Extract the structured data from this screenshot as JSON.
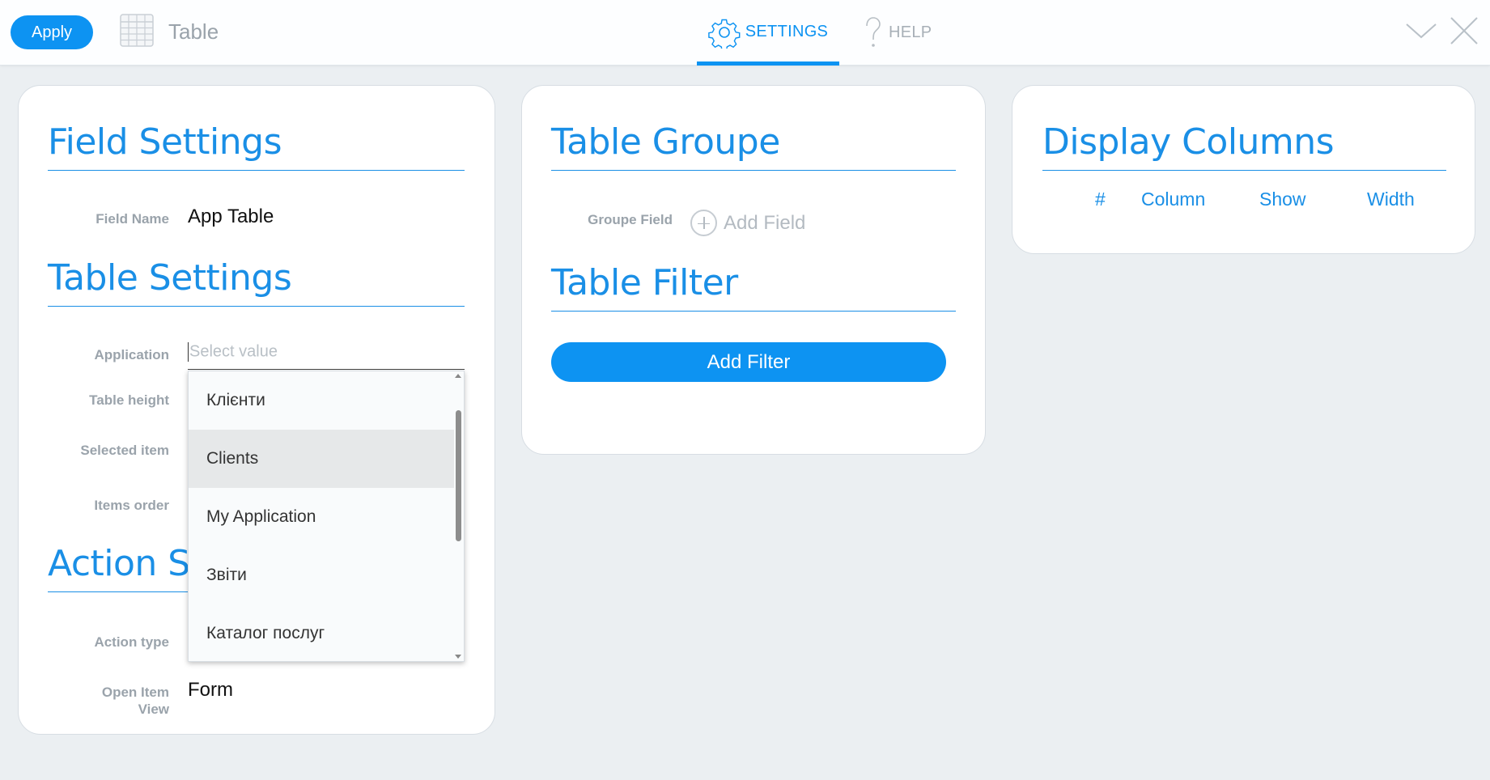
{
  "header": {
    "apply_label": "Apply",
    "title": "Table",
    "tabs": [
      {
        "label": "SETTINGS",
        "icon": "gear-icon",
        "active": true
      },
      {
        "label": "HELP",
        "icon": "question-icon",
        "active": false
      }
    ],
    "controls": [
      "chevron-down-icon",
      "close-icon"
    ]
  },
  "field_settings": {
    "title": "Field Settings",
    "field_name_label": "Field Name",
    "field_name_value": "App Table"
  },
  "table_settings": {
    "title": "Table Settings",
    "application_label": "Application",
    "application_placeholder": "Select value",
    "table_height_label": "Table height",
    "selected_item_label": "Selected item",
    "items_order_label": "Items order",
    "dropdown_options": [
      "Клієнти",
      "Clients",
      "My Application",
      "Звіти",
      "Каталог послуг"
    ],
    "dropdown_highlighted": "Clients"
  },
  "action_settings": {
    "title": "Action Se",
    "action_type_label": "Action type",
    "open_item_view_label_1": "Open Item",
    "open_item_view_label_2": "View",
    "open_item_view_value": "Form"
  },
  "table_groupe": {
    "title": "Table Groupe",
    "groupe_field_label": "Groupe Field",
    "add_field_label": "Add Field"
  },
  "table_filter": {
    "title": "Table Filter",
    "add_filter_label": "Add Filter"
  },
  "display_columns": {
    "title": "Display Columns",
    "headers": [
      "#",
      "Column",
      "Show",
      "Width"
    ]
  },
  "colors": {
    "accent": "#0d93f2",
    "title_blue": "#1a8fe6",
    "label_gray": "#9aa3ab",
    "background": "#ebeff2"
  }
}
